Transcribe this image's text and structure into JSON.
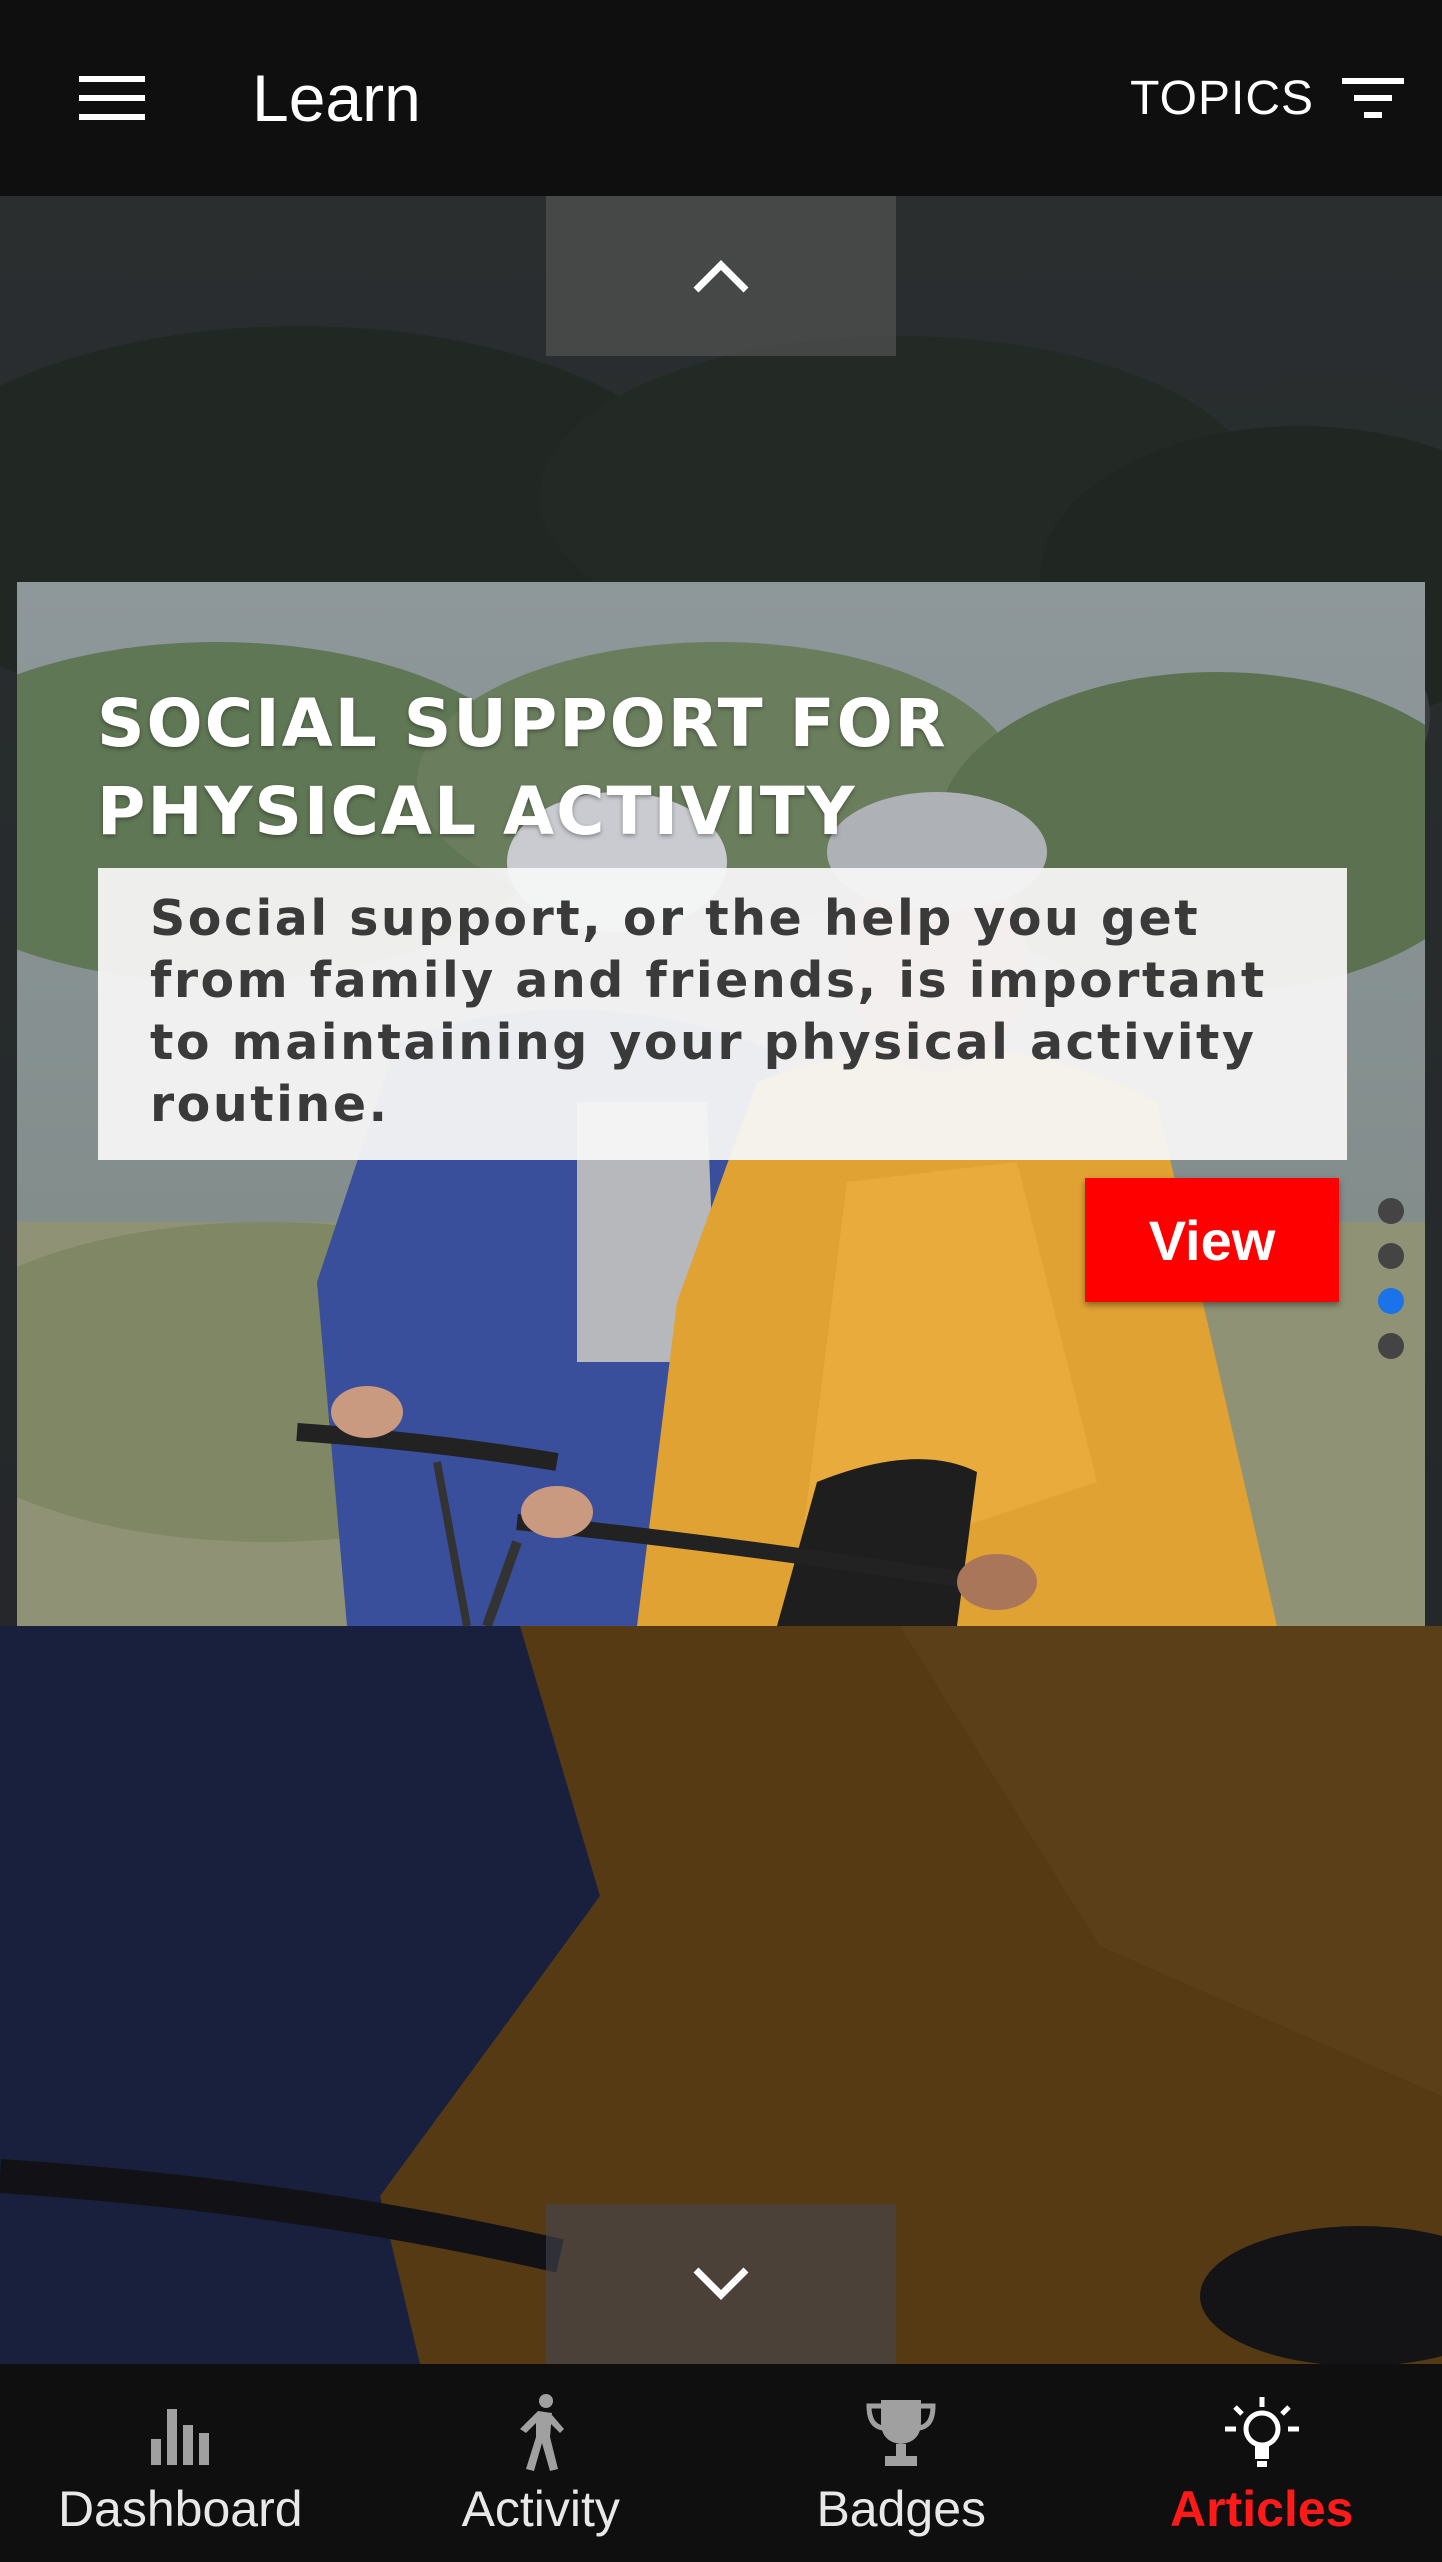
{
  "header": {
    "title": "Learn",
    "topics_label": "TOPICS",
    "menu_icon": "hamburger-menu-icon",
    "filter_icon": "filter-icon"
  },
  "carousel": {
    "up_icon": "chevron-up-icon",
    "down_icon": "chevron-down-icon",
    "total_pages": 4,
    "active_index": 2
  },
  "article": {
    "title": "SOCIAL SUPPORT FOR PHYSICAL ACTIVITY",
    "description": "Social support, or the help you get from family and friends, is important to maintaining your physical activity routine.",
    "view_label": "View"
  },
  "bottom_nav": {
    "items": [
      {
        "label": "Dashboard",
        "icon": "bar-chart-icon",
        "active": false
      },
      {
        "label": "Activity",
        "icon": "walking-person-icon",
        "active": false
      },
      {
        "label": "Badges",
        "icon": "trophy-icon",
        "active": false
      },
      {
        "label": "Articles",
        "icon": "lightbulb-icon",
        "active": true
      }
    ]
  },
  "colors": {
    "accent": "#ff0000",
    "active_dot": "#1a73e8",
    "bar_background": "#0f0f0f"
  }
}
